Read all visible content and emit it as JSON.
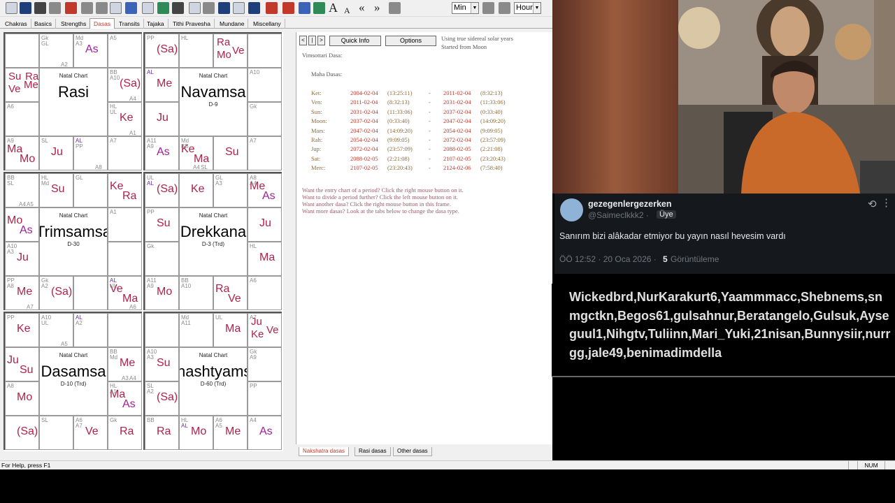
{
  "toolbar": {
    "minutes_value": "Min",
    "hours_value": "Hour",
    "icons": [
      "new-icon",
      "open-icon",
      "save-icon",
      "print-icon",
      "chart-icon",
      "data-icon",
      "settings-icon",
      "compass-icon",
      "globe-icon",
      "special-icon",
      "pen-icon",
      "n-icon",
      "grid-icon",
      "sun-icon",
      "sb-icon",
      "table-icon",
      "book-icon",
      "people-icon",
      "fire-icon",
      "facebook-icon",
      "twitter-icon",
      "font-large-icon",
      "font-small-icon",
      "back-icon",
      "forward-icon",
      "time-back-icon"
    ]
  },
  "tabs": [
    "Chakras",
    "Basics",
    "Strengths",
    "Dasas",
    "Transits",
    "Tajaka",
    "Tithi Pravesha",
    "Mundane",
    "Miscellany"
  ],
  "active_tab": "Dasas",
  "charts": [
    {
      "title": "Natal Chart",
      "name": "Rasi",
      "sub": "",
      "cells": [
        {
          "planets": [],
          "small": []
        },
        {
          "planets": [],
          "small": [
            {
              "t": "Gk"
            },
            {
              "t": "GL"
            },
            {
              "t": "A2"
            }
          ]
        },
        {
          "planets": [
            {
              "t": "As",
              "c": "pm"
            }
          ],
          "small": [
            {
              "t": "Md"
            },
            {
              "t": "A3"
            }
          ]
        },
        {
          "planets": [],
          "small": [
            {
              "t": "A5"
            }
          ]
        },
        {
          "planets": [
            {
              "t": "Me"
            },
            {
              "t": "Su"
            },
            {
              "t": "Ve"
            },
            {
              "t": "Ra"
            }
          ],
          "small": []
        },
        {
          "planets": [
            {
              "t": "(Sa)"
            }
          ],
          "small": [
            {
              "t": "BB"
            },
            {
              "t": "A10"
            },
            {
              "t": "A4"
            }
          ]
        },
        {
          "planets": [],
          "small": [
            {
              "t": "A6"
            }
          ]
        },
        {
          "planets": [
            {
              "t": "Ke"
            }
          ],
          "small": [
            {
              "t": "HL"
            },
            {
              "t": "UL"
            },
            {
              "t": "A1"
            }
          ]
        },
        {
          "planets": [
            {
              "t": "Ma"
            },
            {
              "t": "Mo"
            }
          ],
          "small": [
            {
              "t": "A9"
            }
          ]
        },
        {
          "planets": [
            {
              "t": "Ju"
            }
          ],
          "small": [
            {
              "t": "SL"
            }
          ]
        },
        {
          "planets": [],
          "small": [
            {
              "t": "AL",
              "al": true
            },
            {
              "t": "PP"
            },
            {
              "t": "A8"
            }
          ]
        },
        {
          "planets": [],
          "small": [
            {
              "t": "A7"
            }
          ]
        }
      ]
    },
    {
      "title": "Natal Chart",
      "name": "Navamsa",
      "sub": "D-9",
      "cells": [
        {
          "planets": [
            {
              "t": "(Sa)"
            }
          ],
          "small": [
            {
              "t": "PP"
            }
          ]
        },
        {
          "planets": [],
          "small": [
            {
              "t": "HL"
            }
          ]
        },
        {
          "planets": [
            {
              "t": "Ve"
            },
            {
              "t": "Ra"
            },
            {
              "t": "Mo"
            }
          ],
          "small": []
        },
        {
          "planets": [],
          "small": []
        },
        {
          "planets": [
            {
              "t": "Me"
            }
          ],
          "small": [
            {
              "t": "AL",
              "al": true
            }
          ]
        },
        {
          "planets": [],
          "small": [
            {
              "t": "A10"
            }
          ]
        },
        {
          "planets": [
            {
              "t": "Ju"
            }
          ],
          "small": []
        },
        {
          "planets": [],
          "small": [
            {
              "t": "Gk"
            }
          ]
        },
        {
          "planets": [
            {
              "t": "As",
              "c": "pm"
            }
          ],
          "small": [
            {
              "t": "A11"
            },
            {
              "t": "A9"
            }
          ]
        },
        {
          "planets": [
            {
              "t": "Ke"
            },
            {
              "t": "Ma"
            }
          ],
          "small": [
            {
              "t": "Md"
            },
            {
              "t": "BB"
            },
            {
              "t": "SL"
            },
            {
              "t": "A4"
            }
          ]
        },
        {
          "planets": [
            {
              "t": "Su"
            }
          ],
          "small": []
        },
        {
          "planets": [],
          "small": [
            {
              "t": "A7"
            }
          ]
        }
      ]
    },
    {
      "title": "Natal Chart",
      "name": "Trimsamsa",
      "sub": "D-30",
      "cells": [
        {
          "planets": [],
          "small": [
            {
              "t": "BB"
            },
            {
              "t": "SL"
            },
            {
              "t": "A5"
            },
            {
              "t": "A4"
            }
          ]
        },
        {
          "planets": [
            {
              "t": "Su"
            }
          ],
          "small": [
            {
              "t": "HL"
            },
            {
              "t": "Md"
            }
          ]
        },
        {
          "planets": [],
          "small": [
            {
              "t": "GL"
            }
          ]
        },
        {
          "planets": [
            {
              "t": "Ke"
            },
            {
              "t": "Ra"
            }
          ],
          "small": []
        },
        {
          "planets": [
            {
              "t": "Mo"
            },
            {
              "t": "As",
              "c": "pm"
            }
          ],
          "small": []
        },
        {
          "planets": [],
          "small": [
            {
              "t": "A1"
            }
          ]
        },
        {
          "planets": [
            {
              "t": "Ju"
            }
          ],
          "small": [
            {
              "t": "A10"
            },
            {
              "t": "A3"
            }
          ]
        },
        {
          "planets": [],
          "small": []
        },
        {
          "planets": [
            {
              "t": "Me"
            }
          ],
          "small": [
            {
              "t": "PP"
            },
            {
              "t": "A8"
            },
            {
              "t": "A7"
            }
          ]
        },
        {
          "planets": [
            {
              "t": "(Sa)"
            }
          ],
          "small": [
            {
              "t": "Gk"
            },
            {
              "t": "A2"
            }
          ]
        },
        {
          "planets": [],
          "small": []
        },
        {
          "planets": [
            {
              "t": "Ve"
            },
            {
              "t": "Ma"
            }
          ],
          "small": [
            {
              "t": "AL",
              "al": true
            },
            {
              "t": "UL"
            },
            {
              "t": "A6"
            }
          ]
        }
      ]
    },
    {
      "title": "Natal Chart",
      "name": "Drekkana",
      "sub": "D-3 (Trd)",
      "cells": [
        {
          "planets": [
            {
              "t": "(Sa)"
            }
          ],
          "small": [
            {
              "t": "UL"
            },
            {
              "t": "AL",
              "al": true
            }
          ]
        },
        {
          "planets": [
            {
              "t": "Ke"
            }
          ],
          "small": []
        },
        {
          "planets": [],
          "small": [
            {
              "t": "GL"
            },
            {
              "t": "A3"
            }
          ]
        },
        {
          "planets": [
            {
              "t": "Me"
            },
            {
              "t": "As",
              "c": "pm"
            }
          ],
          "small": [
            {
              "t": "A8"
            },
            {
              "t": "A4"
            }
          ]
        },
        {
          "planets": [
            {
              "t": "Su"
            }
          ],
          "small": [
            {
              "t": "PP"
            }
          ]
        },
        {
          "planets": [
            {
              "t": "Ju"
            }
          ],
          "small": []
        },
        {
          "planets": [],
          "small": [
            {
              "t": "Gk"
            }
          ]
        },
        {
          "planets": [
            {
              "t": "Ma"
            }
          ],
          "small": [
            {
              "t": "HL"
            }
          ]
        },
        {
          "planets": [
            {
              "t": "Mo"
            }
          ],
          "small": [
            {
              "t": "A11"
            },
            {
              "t": "A9"
            }
          ]
        },
        {
          "planets": [],
          "small": [
            {
              "t": "BB"
            },
            {
              "t": "A10"
            }
          ]
        },
        {
          "planets": [
            {
              "t": "Ra"
            },
            {
              "t": "Ve"
            }
          ],
          "small": []
        },
        {
          "planets": [],
          "small": [
            {
              "t": "A6"
            }
          ]
        }
      ]
    },
    {
      "title": "Natal Chart",
      "name": "Dasamsa",
      "sub": "D-10 (Trd)",
      "cells": [
        {
          "planets": [
            {
              "t": "Ke"
            }
          ],
          "small": [
            {
              "t": "PP"
            }
          ]
        },
        {
          "planets": [],
          "small": [
            {
              "t": "A10"
            },
            {
              "t": "UL"
            },
            {
              "t": "A5"
            }
          ]
        },
        {
          "planets": [],
          "small": [
            {
              "t": "AL",
              "al": true
            },
            {
              "t": "A2"
            }
          ]
        },
        {
          "planets": [],
          "small": []
        },
        {
          "planets": [
            {
              "t": "Ju"
            },
            {
              "t": "Su"
            }
          ],
          "small": []
        },
        {
          "planets": [
            {
              "t": "Me"
            }
          ],
          "small": [
            {
              "t": "BB"
            },
            {
              "t": "Md"
            },
            {
              "t": "A4"
            },
            {
              "t": "A3"
            }
          ]
        },
        {
          "planets": [
            {
              "t": "Mo"
            }
          ],
          "small": [
            {
              "t": "A8"
            }
          ]
        },
        {
          "planets": [
            {
              "t": "Ma"
            },
            {
              "t": "As",
              "c": "pm"
            }
          ],
          "small": [
            {
              "t": "HL"
            },
            {
              "t": "A1"
            }
          ]
        },
        {
          "planets": [
            {
              "t": "(Sa)"
            }
          ],
          "small": []
        },
        {
          "planets": [],
          "small": [
            {
              "t": "SL"
            }
          ]
        },
        {
          "planets": [
            {
              "t": "Ve"
            }
          ],
          "small": [
            {
              "t": "A6"
            },
            {
              "t": "A7"
            }
          ]
        },
        {
          "planets": [
            {
              "t": "Ra"
            }
          ],
          "small": [
            {
              "t": "Gk"
            }
          ]
        }
      ]
    },
    {
      "title": "Natal Chart",
      "name": "Shashtyamsa",
      "sub": "D-60 (Trd)",
      "cells": [
        {
          "planets": [],
          "small": []
        },
        {
          "planets": [],
          "small": [
            {
              "t": "Md"
            },
            {
              "t": "A11"
            }
          ]
        },
        {
          "planets": [
            {
              "t": "Ma"
            }
          ],
          "small": [
            {
              "t": "UL"
            }
          ]
        },
        {
          "planets": [
            {
              "t": "Ve"
            },
            {
              "t": "Ju"
            },
            {
              "t": "Ke"
            }
          ],
          "small": [
            {
              "t": "A7"
            }
          ]
        },
        {
          "planets": [
            {
              "t": "Su"
            }
          ],
          "small": [
            {
              "t": "A10"
            },
            {
              "t": "A3"
            }
          ]
        },
        {
          "planets": [],
          "small": [
            {
              "t": "Gk"
            },
            {
              "t": "A9"
            }
          ]
        },
        {
          "planets": [
            {
              "t": "(Sa)"
            }
          ],
          "small": [
            {
              "t": "SL"
            },
            {
              "t": "A2"
            }
          ]
        },
        {
          "planets": [],
          "small": [
            {
              "t": "PP"
            }
          ]
        },
        {
          "planets": [
            {
              "t": "Ra"
            }
          ],
          "small": [
            {
              "t": "BB"
            }
          ]
        },
        {
          "planets": [
            {
              "t": "Mo"
            }
          ],
          "small": [
            {
              "t": "HL"
            },
            {
              "t": "AL",
              "al": true
            }
          ]
        },
        {
          "planets": [
            {
              "t": "Me"
            }
          ],
          "small": [
            {
              "t": "A6"
            },
            {
              "t": "A5"
            }
          ]
        },
        {
          "planets": [
            {
              "t": "As",
              "c": "pm"
            }
          ],
          "small": [
            {
              "t": "A4"
            }
          ]
        }
      ]
    }
  ],
  "dasa_panel": {
    "nav_buttons": [
      "<",
      "|",
      ">"
    ],
    "quick_info_label": "Quick Info",
    "options_label": "Options",
    "info_line1": "Using true sidereal solar years",
    "info_line2": "Started from Moon",
    "heading": "Vimsottari Dasa:",
    "subheading": "Maha Dasas:",
    "rows": [
      {
        "name": "Ket:",
        "start": "2004-02-04",
        "stime": "(13:25:11)",
        "end": "2011-02-04",
        "etime": "(8:32:13)"
      },
      {
        "name": "Ven:",
        "start": "2011-02-04",
        "stime": "(8:32:13)",
        "end": "2031-02-04",
        "etime": "(11:33:06)"
      },
      {
        "name": "Sun:",
        "start": "2031-02-04",
        "stime": "(11:33:06)",
        "end": "2037-02-04",
        "etime": "(0:33:40)"
      },
      {
        "name": "Moon:",
        "start": "2037-02-04",
        "stime": "(0:33:40)",
        "end": "2047-02-04",
        "etime": "(14:09:20)"
      },
      {
        "name": "Mars:",
        "start": "2047-02-04",
        "stime": "(14:09:20)",
        "end": "2054-02-04",
        "etime": "(9:09:05)"
      },
      {
        "name": "Rah:",
        "start": "2054-02-04",
        "stime": "(9:09:05)",
        "end": "2072-02-04",
        "etime": "(23:57:09)"
      },
      {
        "name": "Jup:",
        "start": "2072-02-04",
        "stime": "(23:57:09)",
        "end": "2088-02-05",
        "etime": "(2:21:08)"
      },
      {
        "name": "Sat:",
        "start": "2088-02-05",
        "stime": "(2:21:08)",
        "end": "2107-02-05",
        "etime": "(23:20:43)"
      },
      {
        "name": "Merc:",
        "start": "2107-02-05",
        "stime": "(23:20:43)",
        "end": "2124-02-06",
        "etime": "(7:58:40)"
      }
    ],
    "separator": "-",
    "hints": [
      "Want the entry chart of a period? Click the right mouse button on it.",
      "Want to divide a period further? Click the left mouse button on it.",
      "Want another dasa? Click the right mouse button in this frame.",
      "Want more dasas? Look at the tabs below to change the dasa type."
    ]
  },
  "bottom_tabs": [
    "Nakshatra dasas",
    "Rasi dasas",
    "Other dasas"
  ],
  "status": {
    "help": "For Help, press F1",
    "num": "NUM"
  },
  "tweet": {
    "name": "gezegenlergezerken",
    "handle": "@Saimeclkkk2 ·",
    "badge": "Üye",
    "text": "Sanırım bizi alâkadar etmiyor bu yayın nasıl hevesim vardı",
    "meta_time": "ÖÖ 12:52 · 20 Oca 2026 ·",
    "views_count": "5",
    "views_label": "Görüntüleme"
  },
  "overlay_text": "Wickedbrd,NurKarakurt6,Yaammmacc,Shebnems,snmgctkn,Begos61,gulsahnur,Beratangelo,Gulsuk,Ayseguul1,Nihgtv,Tuliinn,Mari_Yuki,21nisan,Bunnysiir,nurrgg,jale49,benimadimdella"
}
